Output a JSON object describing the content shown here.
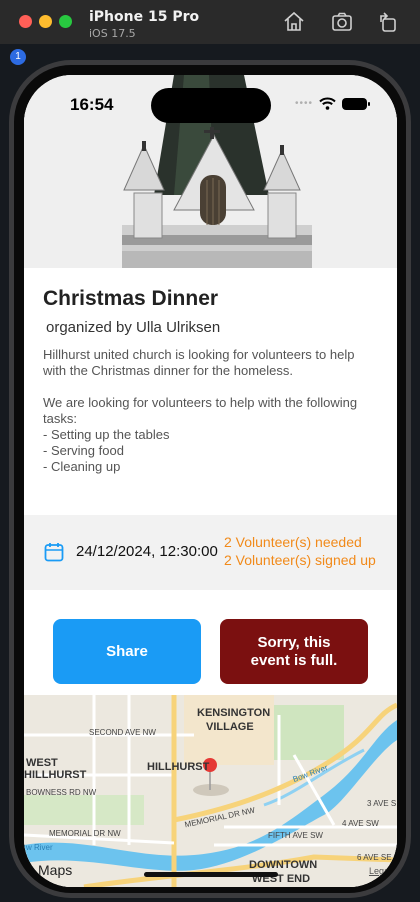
{
  "simulator": {
    "device_name": "iPhone 15 Pro",
    "os_version": "iOS 17.5",
    "badge_count": "1",
    "toolbar_icons": [
      "home-icon",
      "screenshot-icon",
      "rotate-icon"
    ]
  },
  "status_bar": {
    "time": "16:54",
    "signal": "••••"
  },
  "event": {
    "title": "Christmas Dinner",
    "organizer": " organized by Ulla Ulriksen",
    "description": "Hillhurst united church is looking for volunteers to help with the Christmas dinner for the homeless.\n\nWe are looking for volunteers to help with the following tasks:\n- Setting up the tables\n- Serving food\n- Cleaning up",
    "date": "24/12/2024, 12:30:00",
    "volunteers_needed": "2 Volunteer(s) needed",
    "volunteers_signed": "2 Volunteer(s) signed up"
  },
  "buttons": {
    "share": "Share",
    "full": "Sorry, this event is full."
  },
  "map": {
    "labels": {
      "kensington": "KENSINGTON",
      "village": "VILLAGE",
      "west": "WEST",
      "hillhurst_west": "HILLHURST",
      "hillhurst": "HILLHURST",
      "downtown": "DOWNTOWN",
      "west_end": "WEST END"
    },
    "streets": {
      "second_ave": "SECOND AVE NW",
      "bowness": "BOWNESS RD NW",
      "memorial": "MEMORIAL DR NW",
      "memorial_w": "MEMORIAL DR NW",
      "fourth_ave": "4 AVE SW",
      "fifth_ave": "FIFTH AVE SW",
      "six_ave": "6 AVE SE",
      "three_ave": "3 AVE S",
      "bow_river": "Bow River",
      "river_w": "w River"
    },
    "attribution": "Maps",
    "legal": "Legal"
  },
  "colors": {
    "share_button": "#1a9bf5",
    "full_button": "#7b1010",
    "volunteer_text": "#f18a1a",
    "calendar_icon": "#1a9bf5",
    "map_pin": "#e53935"
  }
}
